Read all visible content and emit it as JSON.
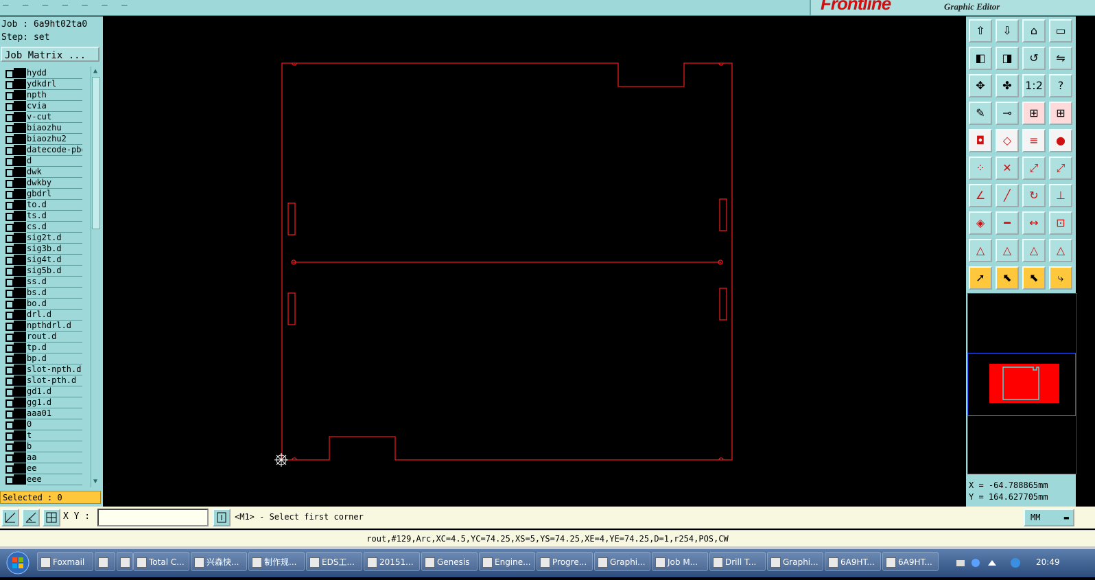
{
  "app": {
    "brand_logo": "Frontline",
    "brand_sub": "Graphic Editor",
    "topbar_fragment": "_ _ _ _ _ _ _"
  },
  "left_panel": {
    "job_line": "Job : 6a9ht02ta0",
    "step_line": "Step: set",
    "job_matrix_label": "Job Matrix ...",
    "layers": [
      "hydd",
      "ydkdrl",
      "npth",
      "cvia",
      "v-cut",
      "biaozhu",
      "biaozhu2",
      "datecode-pbo",
      "d",
      "dwk",
      "dwkby",
      "gbdrl",
      "to.d",
      "ts.d",
      "cs.d",
      "sig2t.d",
      "sig3b.d",
      "sig4t.d",
      "sig5b.d",
      "ss.d",
      "bs.d",
      "bo.d",
      "drl.d",
      "npthdrl.d",
      "rout.d",
      "tp.d",
      "bp.d",
      "slot-npth.d",
      "slot-pth.d",
      "gd1.d",
      "gg1.d",
      "aaa01",
      "0",
      "t",
      "b",
      "aa",
      "ee",
      "eee"
    ],
    "selected_label": "Selected : 0"
  },
  "canvas": {
    "outline_color": "#e8181c",
    "background": "#000000"
  },
  "coords": {
    "x_line": "X = -64.788865mm",
    "y_line": "Y = 164.627705mm"
  },
  "command": {
    "xy_label": "X Y :",
    "xy_value": "",
    "prompt": "<M1> - Select first corner",
    "units": "MM"
  },
  "status_line": "rout,#129,Arc,XC=4.5,YC=74.25,XS=5,YS=74.25,XE=4,YE=74.25,D=1,r254,POS,CW",
  "taskbar": {
    "items": [
      "Foxmail",
      "",
      "",
      "Total C...",
      "兴森快...",
      "制作规...",
      "EDS工...",
      "20151...",
      "Genesis",
      "Engine...",
      "Progre...",
      "Graphi...",
      "Job M...",
      "Drill T...",
      "Graphi...",
      "6A9HT...",
      "6A9HT..."
    ],
    "clock": "20:49"
  },
  "toolbar_icons": [
    "open-icon",
    "save-icon",
    "home-icon",
    "window-icon",
    "import-icon",
    "export-icon",
    "undo-icon",
    "flip-icon",
    "fit-icon",
    "zoom-icon",
    "scale-icon",
    "help-icon",
    "tools-icon",
    "measure-icon",
    "layer-toggle-icon",
    "layer-toggle2-icon",
    "snap-icon",
    "select-box-icon",
    "ruler-icon",
    "pad-icon",
    "net-icon",
    "cross-icon",
    "connect-icon",
    "connect2-icon",
    "angle-icon",
    "line-icon",
    "arc-icon",
    "mirror-icon",
    "move-pad-icon",
    "minus-icon",
    "dimension-icon",
    "group-icon",
    "triangle-icon",
    "triangle2-icon",
    "triangle3-icon",
    "triangle4-icon",
    "pointer-icon",
    "pointer-box-icon",
    "pointer-circle-icon",
    "route-icon"
  ]
}
